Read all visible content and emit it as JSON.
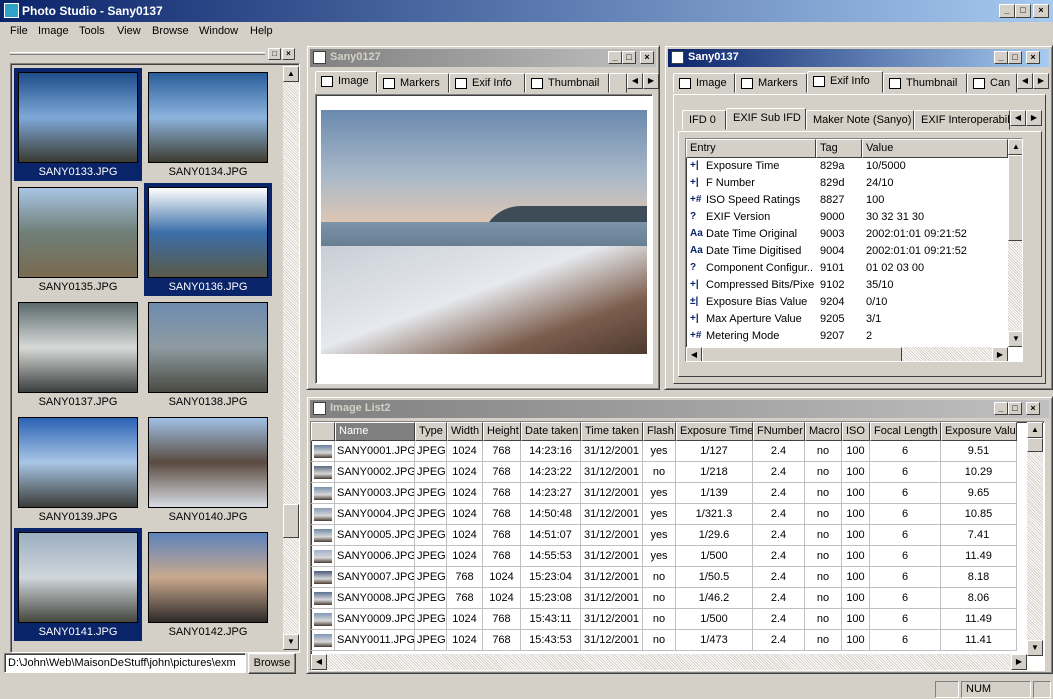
{
  "app": {
    "title": "Photo Studio - Sany0137"
  },
  "menu": [
    "File",
    "Image",
    "Tools",
    "View",
    "Browse",
    "Window",
    "Help"
  ],
  "browser": {
    "thumbs": [
      {
        "label": "SANY0133.JPG",
        "selected": true,
        "colors": [
          "#1e4d8a",
          "#7fa9d8",
          "#3a3a32"
        ]
      },
      {
        "label": "SANY0134.JPG",
        "selected": false,
        "colors": [
          "#2a5d9a",
          "#8cb4de",
          "#3e3c30"
        ]
      },
      {
        "label": "SANY0135.JPG",
        "selected": false,
        "colors": [
          "#a8c5e4",
          "#6f7f78",
          "#7a6a50"
        ]
      },
      {
        "label": "SANY0136.JPG",
        "selected": true,
        "colors": [
          "#ffffff",
          "#3b6ea8",
          "#5a5a48"
        ]
      },
      {
        "label": "SANY0137.JPG",
        "selected": false,
        "colors": [
          "#5b6a6c",
          "#d8dad8",
          "#3a3e3c"
        ]
      },
      {
        "label": "SANY0138.JPG",
        "selected": false,
        "colors": [
          "#6e8cb0",
          "#8e9ba2",
          "#4a4a42"
        ]
      },
      {
        "label": "SANY0139.JPG",
        "selected": false,
        "colors": [
          "#2b62b4",
          "#a9c6e6",
          "#3a3c38"
        ]
      },
      {
        "label": "SANY0140.JPG",
        "selected": false,
        "colors": [
          "#a0c0e4",
          "#5a4a40",
          "#d8dde4"
        ]
      },
      {
        "label": "SANY0141.JPG",
        "selected": true,
        "colors": [
          "#9bb0c0",
          "#d0d6dc",
          "#45463e"
        ]
      },
      {
        "label": "SANY0142.JPG",
        "selected": false,
        "colors": [
          "#5d82bc",
          "#c9a98e",
          "#2e2a28"
        ]
      }
    ],
    "path": "D:\\John\\Web\\MaisonDeStuff\\john\\pictures\\exm",
    "browse_label": "Browse"
  },
  "image_window": {
    "title": "Sany0127",
    "tabs": [
      "Image",
      "Markers",
      "Exif Info",
      "Thumbnail"
    ]
  },
  "exif_window": {
    "title": "Sany0137",
    "tabs": [
      "Image",
      "Markers",
      "Exif Info",
      "Thumbnail",
      "Can"
    ],
    "subtabs": [
      "IFD 0",
      "EXIF Sub IFD",
      "Maker Note (Sanyo)",
      "EXIF Interoperabil"
    ],
    "headers": [
      "Entry",
      "Tag",
      "Value"
    ],
    "rows": [
      {
        "icon": "+|",
        "entry": "Exposure Time",
        "tag": "829a",
        "value": "10/5000"
      },
      {
        "icon": "+|",
        "entry": "F Number",
        "tag": "829d",
        "value": "24/10"
      },
      {
        "icon": "+#",
        "entry": "ISO Speed Ratings",
        "tag": "8827",
        "value": "100"
      },
      {
        "icon": "?",
        "entry": "EXIF Version",
        "tag": "9000",
        "value": "30 32 31 30"
      },
      {
        "icon": "Aa",
        "entry": "Date Time Original",
        "tag": "9003",
        "value": "2002:01:01 09:21:52"
      },
      {
        "icon": "Aa",
        "entry": "Date Time Digitised",
        "tag": "9004",
        "value": "2002:01:01 09:21:52"
      },
      {
        "icon": "?",
        "entry": "Component Configur...",
        "tag": "9101",
        "value": "01 02 03 00"
      },
      {
        "icon": "+|",
        "entry": "Compressed Bits/Pixel",
        "tag": "9102",
        "value": "35/10"
      },
      {
        "icon": "±|",
        "entry": "Exposure Bias Value",
        "tag": "9204",
        "value": "0/10"
      },
      {
        "icon": "+|",
        "entry": "Max Aperture Value",
        "tag": "9205",
        "value": "3/1"
      },
      {
        "icon": "+#",
        "entry": "Metering Mode",
        "tag": "9207",
        "value": "2"
      }
    ]
  },
  "list_window": {
    "title": "Image List2",
    "headers": [
      "Name",
      "Type",
      "Width",
      "Height",
      "Date taken",
      "Time taken",
      "Flash",
      "Exposure Time",
      "FNumber",
      "Macro",
      "ISO",
      "Focal Length",
      "Exposure Value"
    ],
    "rows": [
      [
        "SANY0001.JPG",
        "JPEG",
        "1024",
        "768",
        "14:23:16",
        "31/12/2001",
        "yes",
        "1/127",
        "2.4",
        "no",
        "100",
        "6",
        "9.51"
      ],
      [
        "SANY0002.JPG",
        "JPEG",
        "1024",
        "768",
        "14:23:22",
        "31/12/2001",
        "no",
        "1/218",
        "2.4",
        "no",
        "100",
        "6",
        "10.29"
      ],
      [
        "SANY0003.JPG",
        "JPEG",
        "1024",
        "768",
        "14:23:27",
        "31/12/2001",
        "yes",
        "1/139",
        "2.4",
        "no",
        "100",
        "6",
        "9.65"
      ],
      [
        "SANY0004.JPG",
        "JPEG",
        "1024",
        "768",
        "14:50:48",
        "31/12/2001",
        "yes",
        "1/321.3",
        "2.4",
        "no",
        "100",
        "6",
        "10.85"
      ],
      [
        "SANY0005.JPG",
        "JPEG",
        "1024",
        "768",
        "14:51:07",
        "31/12/2001",
        "yes",
        "1/29.6",
        "2.4",
        "no",
        "100",
        "6",
        "7.41"
      ],
      [
        "SANY0006.JPG",
        "JPEG",
        "1024",
        "768",
        "14:55:53",
        "31/12/2001",
        "yes",
        "1/500",
        "2.4",
        "no",
        "100",
        "6",
        "11.49"
      ],
      [
        "SANY0007.JPG",
        "JPEG",
        "768",
        "1024",
        "15:23:04",
        "31/12/2001",
        "no",
        "1/50.5",
        "2.4",
        "no",
        "100",
        "6",
        "8.18"
      ],
      [
        "SANY0008.JPG",
        "JPEG",
        "768",
        "1024",
        "15:23:08",
        "31/12/2001",
        "no",
        "1/46.2",
        "2.4",
        "no",
        "100",
        "6",
        "8.06"
      ],
      [
        "SANY0009.JPG",
        "JPEG",
        "1024",
        "768",
        "15:43:11",
        "31/12/2001",
        "no",
        "1/500",
        "2.4",
        "no",
        "100",
        "6",
        "11.49"
      ],
      [
        "SANY0011.JPG",
        "JPEG",
        "1024",
        "768",
        "15:43:53",
        "31/12/2001",
        "no",
        "1/473",
        "2.4",
        "no",
        "100",
        "6",
        "11.41"
      ]
    ]
  },
  "status": {
    "num": "NUM"
  }
}
